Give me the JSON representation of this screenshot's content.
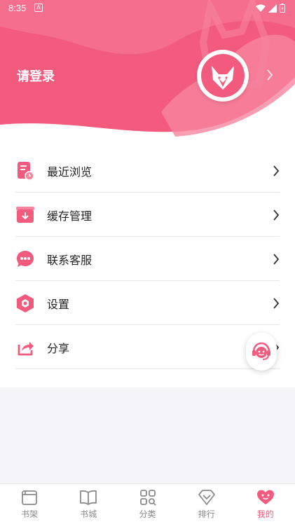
{
  "status_bar": {
    "time": "8:35",
    "notification_glyph": "A"
  },
  "header": {
    "login_label": "请登录"
  },
  "menu": {
    "items": [
      {
        "label": "最近浏览",
        "icon": "recent-history-icon"
      },
      {
        "label": "缓存管理",
        "icon": "cache-download-icon"
      },
      {
        "label": "联系客服",
        "icon": "chat-bubble-icon"
      },
      {
        "label": "设置",
        "icon": "settings-hexagon-icon"
      },
      {
        "label": "分享",
        "icon": "share-icon"
      }
    ]
  },
  "tabs": [
    {
      "label": "书架",
      "icon": "bookshelf-icon",
      "active": false
    },
    {
      "label": "书城",
      "icon": "open-book-icon",
      "active": false
    },
    {
      "label": "分类",
      "icon": "category-grid-icon",
      "active": false
    },
    {
      "label": "排行",
      "icon": "ranking-diamond-icon",
      "active": false
    },
    {
      "label": "我的",
      "icon": "profile-heart-icon",
      "active": true
    }
  ],
  "colors": {
    "accent": "#f25a7e",
    "header_light": "#f7849f",
    "text_primary": "#222222",
    "tab_inactive": "#8a8a8a"
  }
}
